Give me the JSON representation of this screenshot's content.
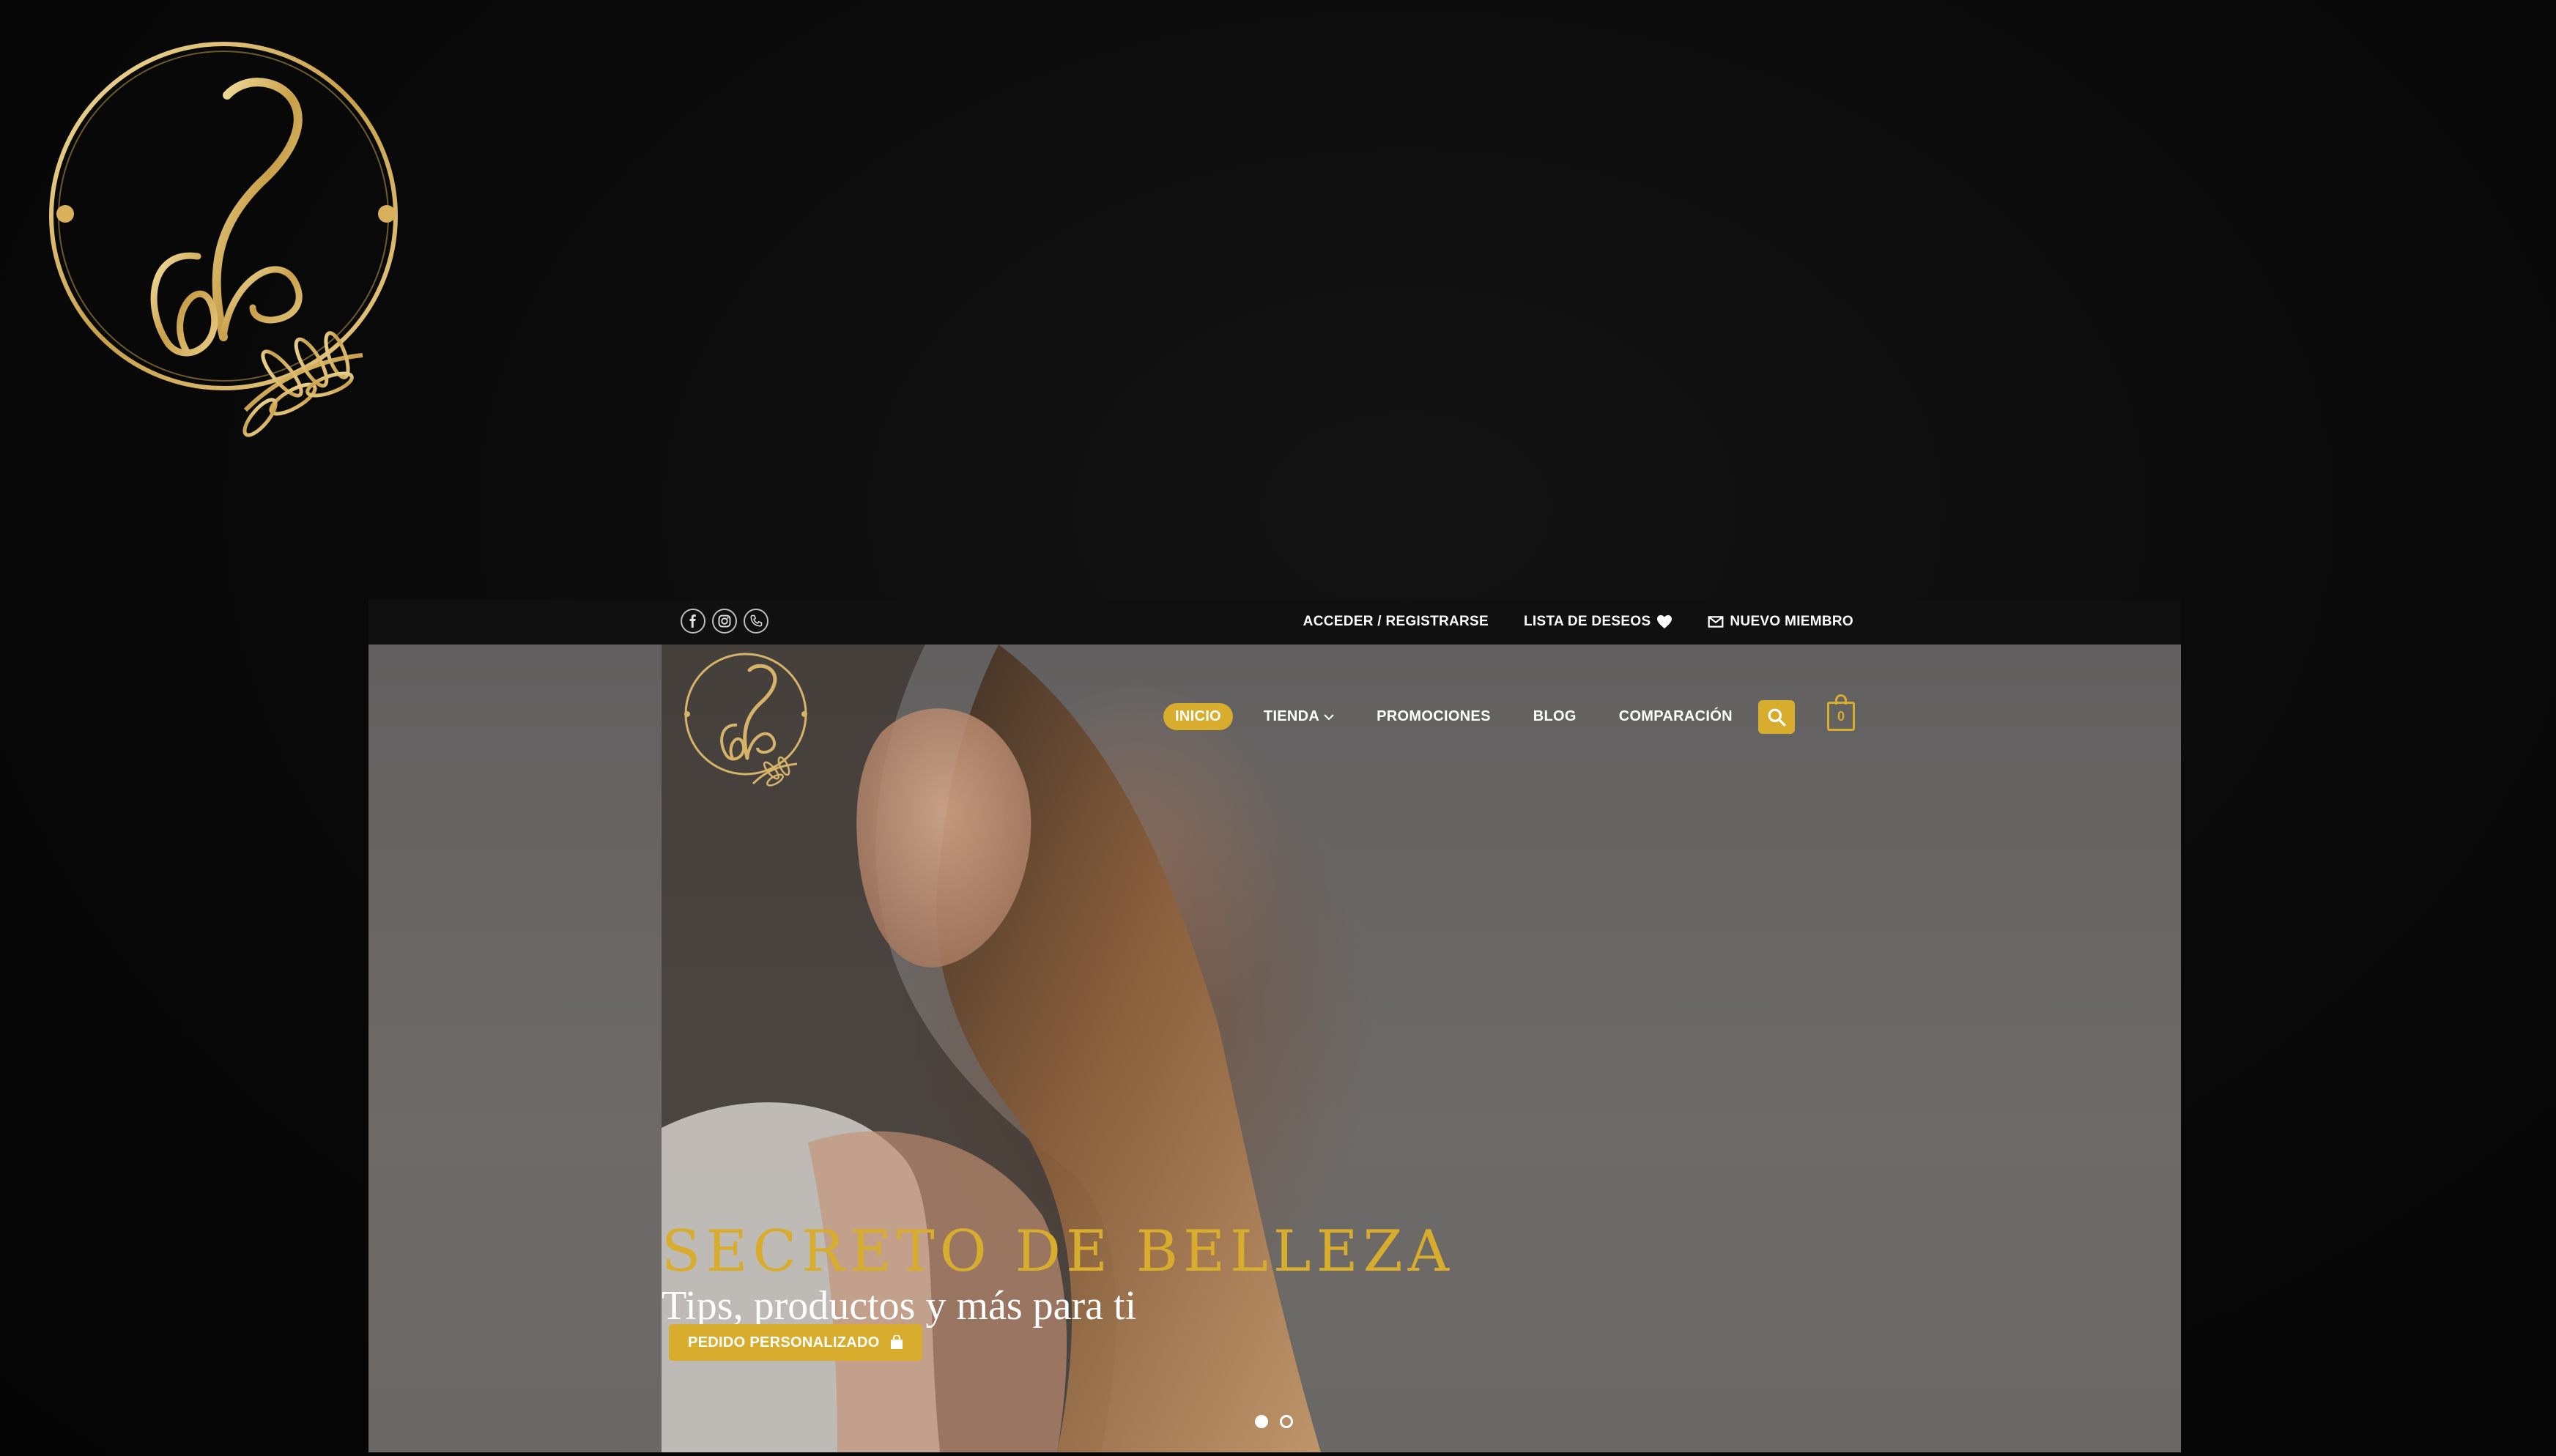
{
  "brand": {
    "logo_text": "sb"
  },
  "topbar": {
    "social": [
      "facebook-icon",
      "instagram-icon",
      "phone-icon"
    ],
    "login": "ACCEDER / REGISTRARSE",
    "wishlist": "LISTA DE DESEOS",
    "newmember": "NUEVO MIEMBRO"
  },
  "nav": {
    "items": [
      "INICIO",
      "TIENDA",
      "PROMOCIONES",
      "BLOG",
      "COMPARACIÓN"
    ],
    "cart_count": "0"
  },
  "hero": {
    "title": "SECRETO DE BELLEZA",
    "subtitle": "Tips, productos y más para ti",
    "cta": "PEDIDO PERSONALIZADO",
    "slide_count": 2,
    "active_slide": 1
  },
  "colors": {
    "accent": "#d8ad2e",
    "background": "#0a0a0a",
    "topbar": "#101010"
  }
}
